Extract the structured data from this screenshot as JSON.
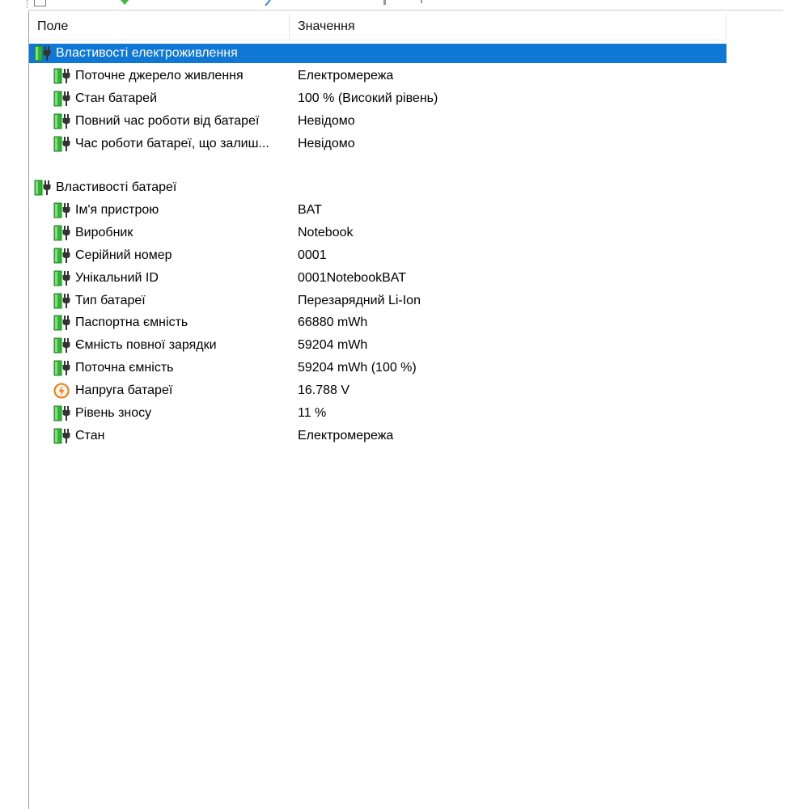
{
  "window": {
    "toolbar_icons": [
      "document-icon",
      "green-check-icon",
      "blue-pencil-icon"
    ]
  },
  "list": {
    "columns": {
      "field": "Поле",
      "value": "Значення"
    },
    "groups": [
      {
        "label": "Властивості електроживлення",
        "selected": true,
        "icon": "battery-plug-icon",
        "items": [
          {
            "label": "Поточне джерело живлення",
            "value": "Електромережа",
            "icon": "battery-plug-icon"
          },
          {
            "label": "Стан батарей",
            "value": "100 % (Високий рівень)",
            "icon": "battery-plug-icon"
          },
          {
            "label": "Повний час роботи від батареї",
            "value": "Невідомо",
            "icon": "battery-plug-icon"
          },
          {
            "label": "Час роботи батареї, що залиш...",
            "value": "Невідомо",
            "icon": "battery-plug-icon"
          }
        ]
      },
      {
        "label": "Властивості батареї",
        "selected": false,
        "icon": "battery-plug-icon",
        "items": [
          {
            "label": "Ім'я пристрою",
            "value": "BAT",
            "icon": "battery-plug-icon"
          },
          {
            "label": "Виробник",
            "value": "Notebook",
            "icon": "battery-plug-icon"
          },
          {
            "label": "Серійний номер",
            "value": "0001",
            "icon": "battery-plug-icon"
          },
          {
            "label": "Унікальний ID",
            "value": "0001NotebookBAT",
            "icon": "battery-plug-icon"
          },
          {
            "label": "Тип батареї",
            "value": "Перезарядний Li-Ion",
            "icon": "battery-plug-icon"
          },
          {
            "label": "Паспортна ємність",
            "value": "66880 mWh",
            "icon": "battery-plug-icon"
          },
          {
            "label": "Ємність повної зарядки",
            "value": "59204 mWh",
            "icon": "battery-plug-icon"
          },
          {
            "label": "Поточна ємність",
            "value": "59204 mWh  (100 %)",
            "icon": "battery-plug-icon"
          },
          {
            "label": "Напруга батареї",
            "value": "16.788 V",
            "icon": "voltage-icon"
          },
          {
            "label": "Рівень зносу",
            "value": "11 %",
            "icon": "battery-plug-icon"
          },
          {
            "label": "Стан",
            "value": "Електромережа",
            "icon": "battery-plug-icon"
          }
        ]
      }
    ]
  },
  "colors": {
    "selection": "#0f78d7",
    "battery_green": "#2fb52f",
    "voltage_orange": "#f07a12"
  }
}
